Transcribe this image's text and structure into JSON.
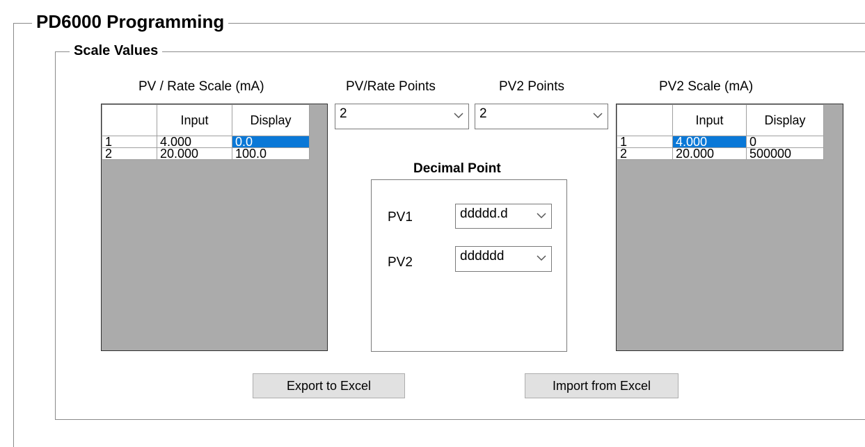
{
  "outer_group": {
    "title": "PD6000 Programming"
  },
  "scale_group": {
    "title": "Scale Values"
  },
  "pv_rate_scale": {
    "caption": "PV / Rate Scale (mA)",
    "headers": [
      "",
      "Input",
      "Display"
    ],
    "rows": [
      {
        "index": "1",
        "input": "4.000",
        "display": "0.0"
      },
      {
        "index": "2",
        "input": "20.000",
        "display": "100.0"
      }
    ]
  },
  "pv_rate_points": {
    "label": "PV/Rate Points",
    "value": "2"
  },
  "pv2_points": {
    "label": "PV2 Points",
    "value": "2"
  },
  "pv2_scale": {
    "caption": "PV2 Scale (mA)",
    "headers": [
      "",
      "Input",
      "Display"
    ],
    "rows": [
      {
        "index": "1",
        "input": "4.000",
        "display": "0"
      },
      {
        "index": "2",
        "input": "20.000",
        "display": "500000"
      }
    ]
  },
  "decimal_point": {
    "title": "Decimal Point",
    "pv1": {
      "label": "PV1",
      "value": "ddddd.d"
    },
    "pv2": {
      "label": "PV2",
      "value": "dddddd"
    }
  },
  "buttons": {
    "export": "Export to Excel",
    "import": "Import from Excel"
  },
  "colors": {
    "selection": "#0a78d7",
    "grid_background": "#ababab",
    "button_face": "#e1e1e1"
  }
}
